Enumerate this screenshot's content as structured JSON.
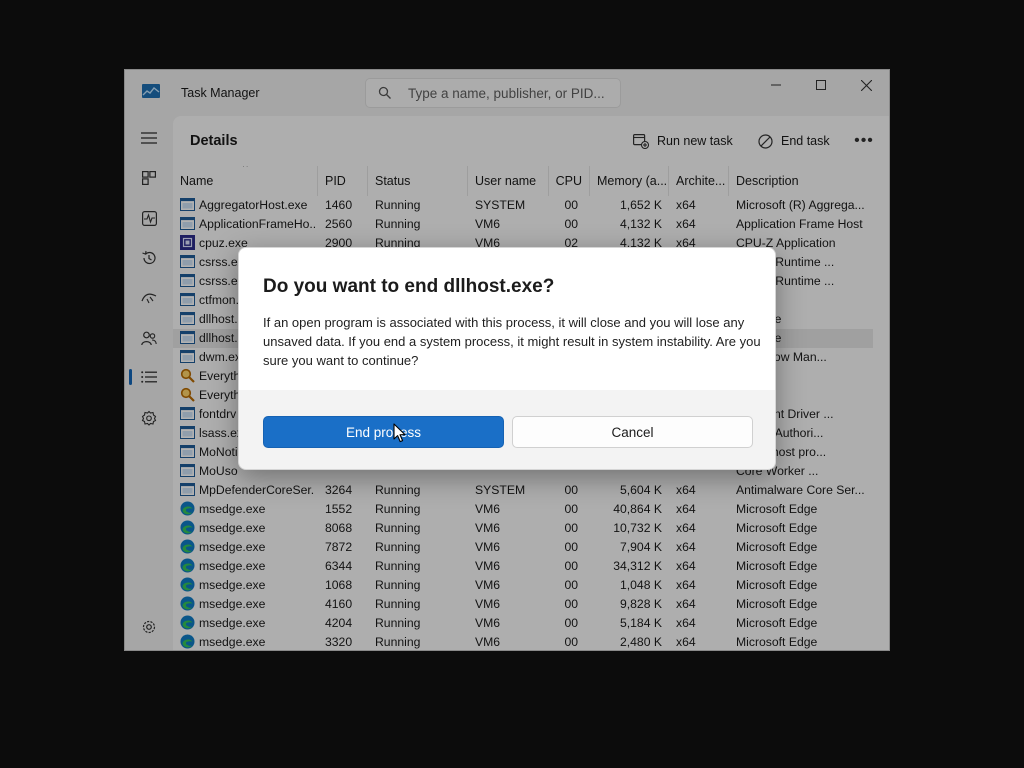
{
  "window": {
    "title": "Task Manager"
  },
  "search": {
    "placeholder": "Type a name, publisher, or PID..."
  },
  "page": {
    "title": "Details",
    "run_new_task": "Run new task",
    "end_task": "End task",
    "more": "•••"
  },
  "table": {
    "columns": [
      "Name",
      "PID",
      "Status",
      "User name",
      "CPU",
      "Memory (a...",
      "Archite...",
      "Description"
    ],
    "rows": [
      {
        "name": "AggregatorHost.exe",
        "pid": "1460",
        "status": "Running",
        "user": "SYSTEM",
        "cpu": "00",
        "memory": "1,652 K",
        "arch": "x64",
        "desc": "Microsoft (R) Aggrega...",
        "icon": "app-window-icon"
      },
      {
        "name": "ApplicationFrameHo...",
        "pid": "2560",
        "status": "Running",
        "user": "VM6",
        "cpu": "00",
        "memory": "4,132 K",
        "arch": "x64",
        "desc": "Application Frame Host",
        "icon": "app-window-icon"
      },
      {
        "name": "cpuz.exe",
        "pid": "2900",
        "status": "Running",
        "user": "VM6",
        "cpu": "02",
        "memory": "4,132 K",
        "arch": "x64",
        "desc": "CPU-Z Application",
        "icon": "cpuz-icon"
      },
      {
        "name": "csrss.exe",
        "pid": "",
        "status": "",
        "user": "",
        "cpu": "",
        "memory": "",
        "arch": "",
        "desc": "Server Runtime ...",
        "icon": "app-window-icon"
      },
      {
        "name": "csrss.exe",
        "pid": "",
        "status": "",
        "user": "",
        "cpu": "",
        "memory": "",
        "arch": "",
        "desc": "Server Runtime ...",
        "icon": "app-window-icon"
      },
      {
        "name": "ctfmon.",
        "pid": "",
        "status": "",
        "user": "",
        "cpu": "",
        "memory": "",
        "arch": "",
        "desc": "ader",
        "icon": "app-window-icon"
      },
      {
        "name": "dllhost.",
        "pid": "",
        "status": "",
        "user": "",
        "cpu": "",
        "memory": "",
        "arch": "",
        "desc": "urrogate",
        "icon": "app-window-icon"
      },
      {
        "name": "dllhost.",
        "pid": "",
        "status": "",
        "user": "",
        "cpu": "",
        "memory": "",
        "arch": "",
        "desc": "urrogate",
        "icon": "app-window-icon",
        "selected": true
      },
      {
        "name": "dwm.ex",
        "pid": "",
        "status": "",
        "user": "",
        "cpu": "",
        "memory": "",
        "arch": "",
        "desc": "p Window Man...",
        "icon": "app-window-icon"
      },
      {
        "name": "Everythi",
        "pid": "",
        "status": "",
        "user": "",
        "cpu": "",
        "memory": "",
        "arch": "",
        "desc": "ing",
        "icon": "everything-search-icon"
      },
      {
        "name": "Everythi",
        "pid": "",
        "status": "",
        "user": "",
        "cpu": "",
        "memory": "",
        "arch": "",
        "desc": "ing",
        "icon": "everything-search-icon"
      },
      {
        "name": "fontdrv",
        "pid": "",
        "status": "",
        "user": "",
        "cpu": "",
        "memory": "",
        "arch": "",
        "desc": "ode Font Driver ...",
        "icon": "app-window-icon"
      },
      {
        "name": "lsass.ex",
        "pid": "",
        "status": "",
        "user": "",
        "cpu": "",
        "memory": "",
        "arch": "",
        "desc": "ecurity Authori...",
        "icon": "app-window-icon"
      },
      {
        "name": "MoNoti",
        "pid": "",
        "status": "",
        "user": "",
        "cpu": "",
        "memory": "",
        "arch": "",
        "desc": "ations host pro...",
        "icon": "app-window-icon"
      },
      {
        "name": "MoUso",
        "pid": "",
        "status": "",
        "user": "",
        "cpu": "",
        "memory": "",
        "arch": "",
        "desc": "Core Worker ...",
        "icon": "app-window-icon"
      },
      {
        "name": "MpDefenderCoreSer...",
        "pid": "3264",
        "status": "Running",
        "user": "SYSTEM",
        "cpu": "00",
        "memory": "5,604 K",
        "arch": "x64",
        "desc": "Antimalware Core Ser...",
        "icon": "app-window-icon"
      },
      {
        "name": "msedge.exe",
        "pid": "1552",
        "status": "Running",
        "user": "VM6",
        "cpu": "00",
        "memory": "40,864 K",
        "arch": "x64",
        "desc": "Microsoft Edge",
        "icon": "edge-icon"
      },
      {
        "name": "msedge.exe",
        "pid": "8068",
        "status": "Running",
        "user": "VM6",
        "cpu": "00",
        "memory": "10,732 K",
        "arch": "x64",
        "desc": "Microsoft Edge",
        "icon": "edge-icon"
      },
      {
        "name": "msedge.exe",
        "pid": "7872",
        "status": "Running",
        "user": "VM6",
        "cpu": "00",
        "memory": "7,904 K",
        "arch": "x64",
        "desc": "Microsoft Edge",
        "icon": "edge-icon"
      },
      {
        "name": "msedge.exe",
        "pid": "6344",
        "status": "Running",
        "user": "VM6",
        "cpu": "00",
        "memory": "34,312 K",
        "arch": "x64",
        "desc": "Microsoft Edge",
        "icon": "edge-icon"
      },
      {
        "name": "msedge.exe",
        "pid": "1068",
        "status": "Running",
        "user": "VM6",
        "cpu": "00",
        "memory": "1,048 K",
        "arch": "x64",
        "desc": "Microsoft Edge",
        "icon": "edge-icon"
      },
      {
        "name": "msedge.exe",
        "pid": "4160",
        "status": "Running",
        "user": "VM6",
        "cpu": "00",
        "memory": "9,828 K",
        "arch": "x64",
        "desc": "Microsoft Edge",
        "icon": "edge-icon"
      },
      {
        "name": "msedge.exe",
        "pid": "4204",
        "status": "Running",
        "user": "VM6",
        "cpu": "00",
        "memory": "5,184 K",
        "arch": "x64",
        "desc": "Microsoft Edge",
        "icon": "edge-icon"
      },
      {
        "name": "msedge.exe",
        "pid": "3320",
        "status": "Running",
        "user": "VM6",
        "cpu": "00",
        "memory": "2,480 K",
        "arch": "x64",
        "desc": "Microsoft Edge",
        "icon": "edge-icon"
      }
    ]
  },
  "dialog": {
    "title": "Do you want to end dllhost.exe?",
    "body": "If an open program is associated with this process, it will close and you will lose any unsaved data. If you end a system process, it might result in system instability. Are you sure you want to continue?",
    "confirm": "End process",
    "cancel": "Cancel"
  },
  "colors": {
    "accent": "#1a6fc7",
    "overlay": "rgba(0,0,0,0.30)"
  }
}
